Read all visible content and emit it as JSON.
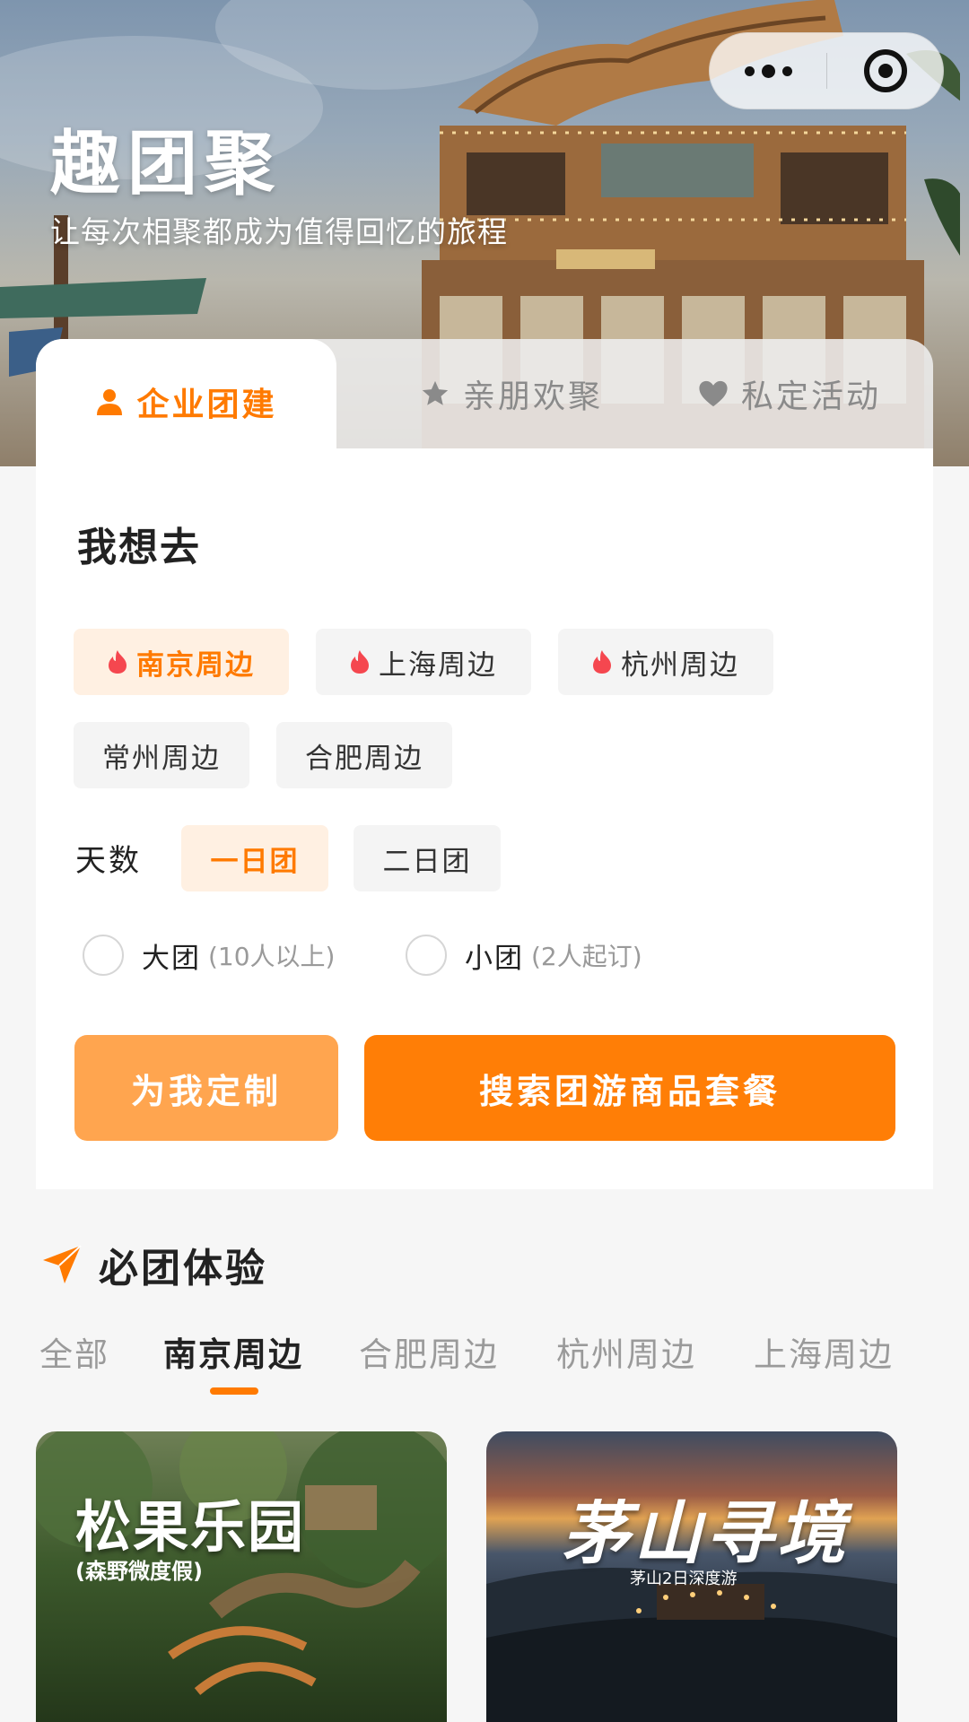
{
  "hero": {
    "title": "趣团聚",
    "subtitle": "让每次相聚都成为值得回忆的旅程"
  },
  "capsule": {
    "more_icon": "more-dots-icon",
    "close_icon": "target-circle-icon"
  },
  "tabs": [
    {
      "label": "企业团建",
      "icon": "person-icon",
      "active": true
    },
    {
      "label": "亲朋欢聚",
      "icon": "star-icon",
      "active": false
    },
    {
      "label": "私定活动",
      "icon": "heart-icon",
      "active": false
    }
  ],
  "planner": {
    "title": "我想去",
    "destinations": [
      {
        "label": "南京周边",
        "hot": true,
        "selected": true
      },
      {
        "label": "上海周边",
        "hot": true,
        "selected": false
      },
      {
        "label": "杭州周边",
        "hot": true,
        "selected": false
      },
      {
        "label": "常州周边",
        "hot": false,
        "selected": false
      },
      {
        "label": "合肥周边",
        "hot": false,
        "selected": false
      }
    ],
    "days_label": "天数",
    "days": [
      {
        "label": "一日团",
        "selected": true
      },
      {
        "label": "二日团",
        "selected": false
      }
    ],
    "group_size": [
      {
        "label": "大团",
        "hint": "(10人以上)",
        "checked": false
      },
      {
        "label": "小团",
        "hint": "(2人起订)",
        "checked": false
      }
    ],
    "custom_button": "为我定制",
    "search_button": "搜索团游商品套餐"
  },
  "must": {
    "title": "必团体验",
    "icon": "paper-plane-icon",
    "tabs": [
      {
        "label": "全部",
        "active": false
      },
      {
        "label": "南京周边",
        "active": true
      },
      {
        "label": "合肥周边",
        "active": false
      },
      {
        "label": "杭州周边",
        "active": false
      },
      {
        "label": "上海周边",
        "active": false
      }
    ],
    "products": [
      {
        "title": "松果乐园",
        "subtitle": "(森野微度假)"
      },
      {
        "title": "茅山寻境",
        "subtitle": "茅山2日深度游"
      }
    ]
  },
  "colors": {
    "accent": "#ff7a00",
    "accent_light": "#ffa54f",
    "chip_selected_bg": "#fff0e2",
    "chip_bg": "#f4f4f4",
    "fire": "#f5474f"
  }
}
